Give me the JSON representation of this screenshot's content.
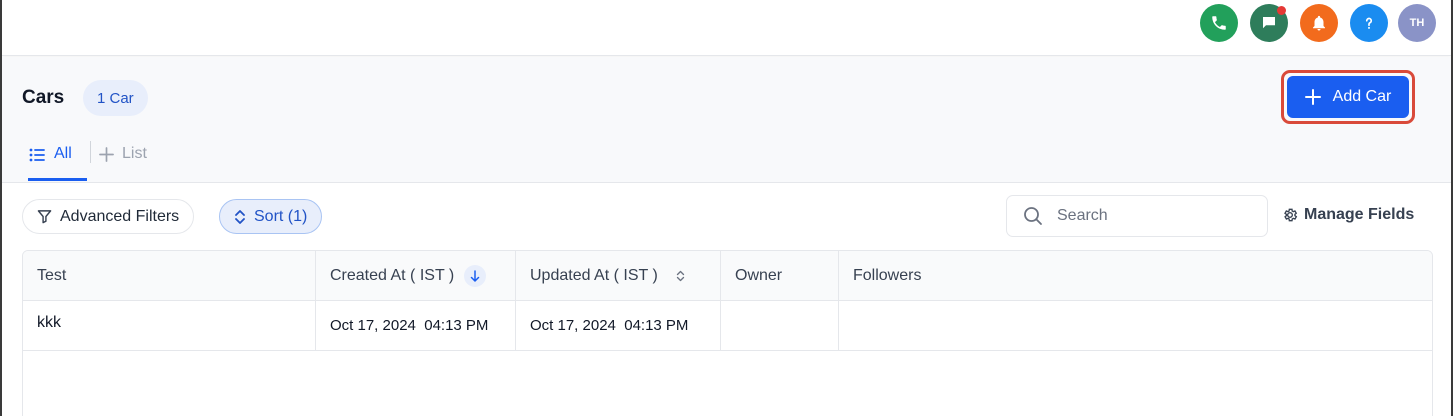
{
  "topbar": {
    "icons": [
      "phone-icon",
      "chat-icon",
      "bell-icon",
      "help-icon"
    ],
    "avatar_initials": "TH",
    "colors": {
      "phone": "#22a05b",
      "chat": "#2e7d5b",
      "bell": "#f26b1d",
      "help": "#1a8cf0",
      "avatar": "#8a93c7"
    }
  },
  "header": {
    "title": "Cars",
    "count_badge": "1 Car",
    "add_button": "Add Car"
  },
  "tabs": [
    {
      "label": "All",
      "active": true,
      "icon": "list-icon"
    },
    {
      "label": "List",
      "active": false,
      "icon": "plus-icon"
    }
  ],
  "toolbar": {
    "filter_label": "Advanced Filters",
    "sort_label": "Sort (1)",
    "search_placeholder": "Search",
    "manage_fields_label": "Manage Fields"
  },
  "table": {
    "columns": [
      "Test",
      "Created At ( IST )",
      "Updated At ( IST )",
      "Owner",
      "Followers"
    ],
    "rows": [
      {
        "test": "kkk",
        "created_at": "Oct 17, 2024  04:13 PM",
        "updated_at": "Oct 17, 2024  04:13 PM",
        "owner": "",
        "followers": ""
      }
    ]
  },
  "colors": {
    "accent": "#1a5ef0",
    "highlight_border": "#d94a3a"
  }
}
